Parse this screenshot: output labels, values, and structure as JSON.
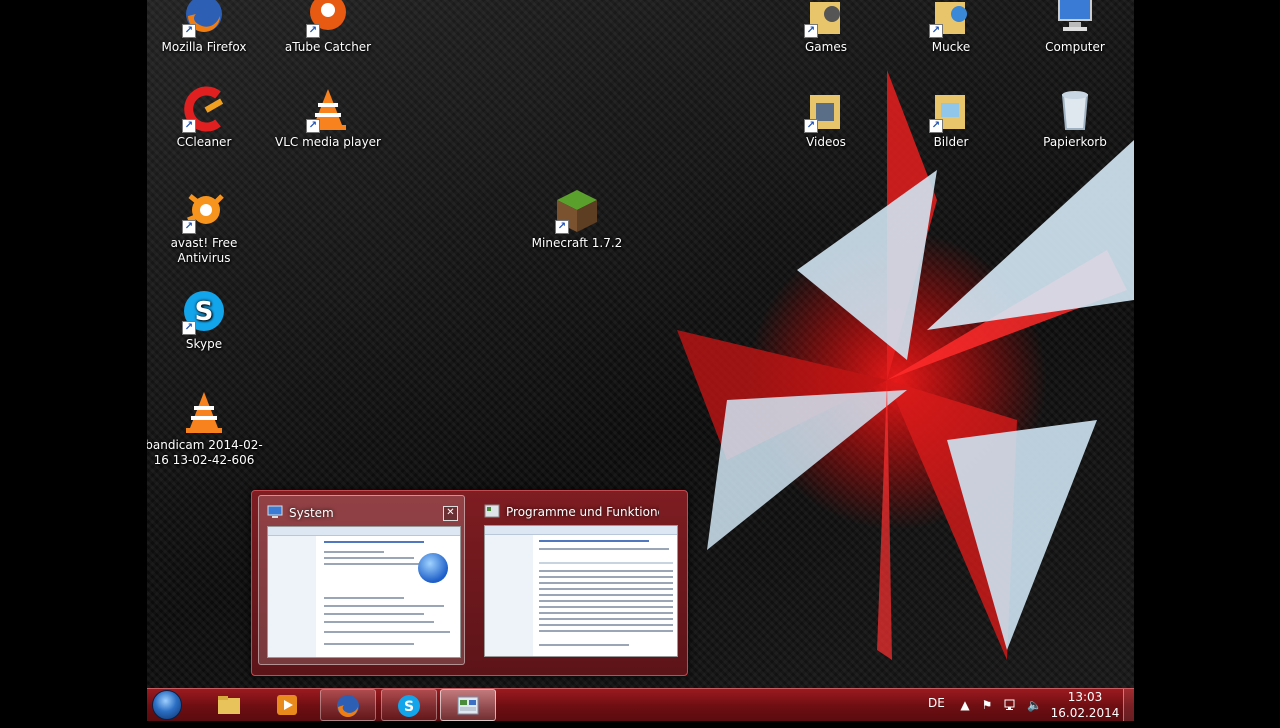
{
  "desktop": {
    "icons": [
      {
        "label": "Mozilla Firefox",
        "icon": "firefox-icon"
      },
      {
        "label": "aTube Catcher",
        "icon": "atube-catcher-icon"
      },
      {
        "label": "CCleaner",
        "icon": "ccleaner-icon"
      },
      {
        "label": "VLC media player",
        "icon": "vlc-icon"
      },
      {
        "label": "avast! Free Antivirus",
        "icon": "avast-icon"
      },
      {
        "label": "Skype",
        "icon": "skype-icon"
      },
      {
        "label": "bandicam 2014-02-16 13-02-42-606",
        "icon": "vlc-cone-icon"
      },
      {
        "label": "Minecraft 1.7.2",
        "icon": "minecraft-icon"
      },
      {
        "label": "Games",
        "icon": "games-folder-icon"
      },
      {
        "label": "Mucke",
        "icon": "music-folder-icon"
      },
      {
        "label": "Computer",
        "icon": "computer-icon"
      },
      {
        "label": "Videos",
        "icon": "videos-folder-icon"
      },
      {
        "label": "Bilder",
        "icon": "pictures-folder-icon"
      },
      {
        "label": "Papierkorb",
        "icon": "recycle-bin-icon"
      }
    ]
  },
  "peek": {
    "windows": [
      {
        "title": "System",
        "icon": "system-icon",
        "active": true,
        "close_label": "✕"
      },
      {
        "title": "Programme und Funktionen",
        "icon": "programs-icon",
        "active": false
      }
    ]
  },
  "taskbar": {
    "start_icon": "windows-orb-icon",
    "buttons": [
      {
        "icon": "explorer-folder-icon",
        "state": "pinned"
      },
      {
        "icon": "media-player-icon",
        "state": "pinned"
      },
      {
        "icon": "firefox-icon",
        "state": "running"
      },
      {
        "icon": "skype-icon",
        "state": "running"
      },
      {
        "icon": "control-panel-icon",
        "state": "active"
      }
    ],
    "tray": {
      "language": "DE",
      "icons": [
        "show-hidden-icons-chevron",
        "action-center-flag-icon",
        "network-icon",
        "volume-icon"
      ],
      "time": "13:03",
      "date": "16.02.2014"
    }
  }
}
